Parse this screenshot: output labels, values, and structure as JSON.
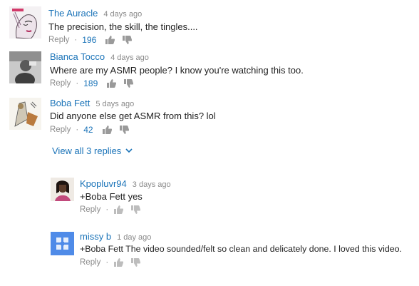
{
  "comments": [
    {
      "author": "The Auracle",
      "time": "4 days ago",
      "text": "The precision, the skill, the tingles....",
      "reply_label": "Reply",
      "likes": "196",
      "avatar_icon": "illustrated-face-avatar"
    },
    {
      "author": "Bianca Tocco",
      "time": "4 days ago",
      "text": "Where are my ASMR people? I know you're watching this too.",
      "reply_label": "Reply",
      "likes": "189",
      "avatar_icon": "photo-avatar"
    },
    {
      "author": "Boba Fett",
      "time": "5 days ago",
      "text": "Did anyone else get ASMR from this? lol",
      "reply_label": "Reply",
      "likes": "42",
      "avatar_icon": "cartoon-figure-avatar"
    }
  ],
  "view_replies_label": "View all 3 replies",
  "replies": [
    {
      "author": "Kpopluvr94",
      "time": "3 days ago",
      "text": "+Boba Fett yes",
      "reply_label": "Reply",
      "avatar_icon": "profile-photo-avatar"
    },
    {
      "author": "missy b",
      "time": "1 day ago",
      "text": "+Boba Fett The video sounded/felt so clean and delicately done. I loved this video.",
      "reply_label": "Reply",
      "avatar_icon": "default-blue-avatar"
    }
  ],
  "colors": {
    "link": "#1a73b8",
    "meta": "#8a8a8a",
    "text": "#222222",
    "default_avatar": "#4f8be8"
  }
}
